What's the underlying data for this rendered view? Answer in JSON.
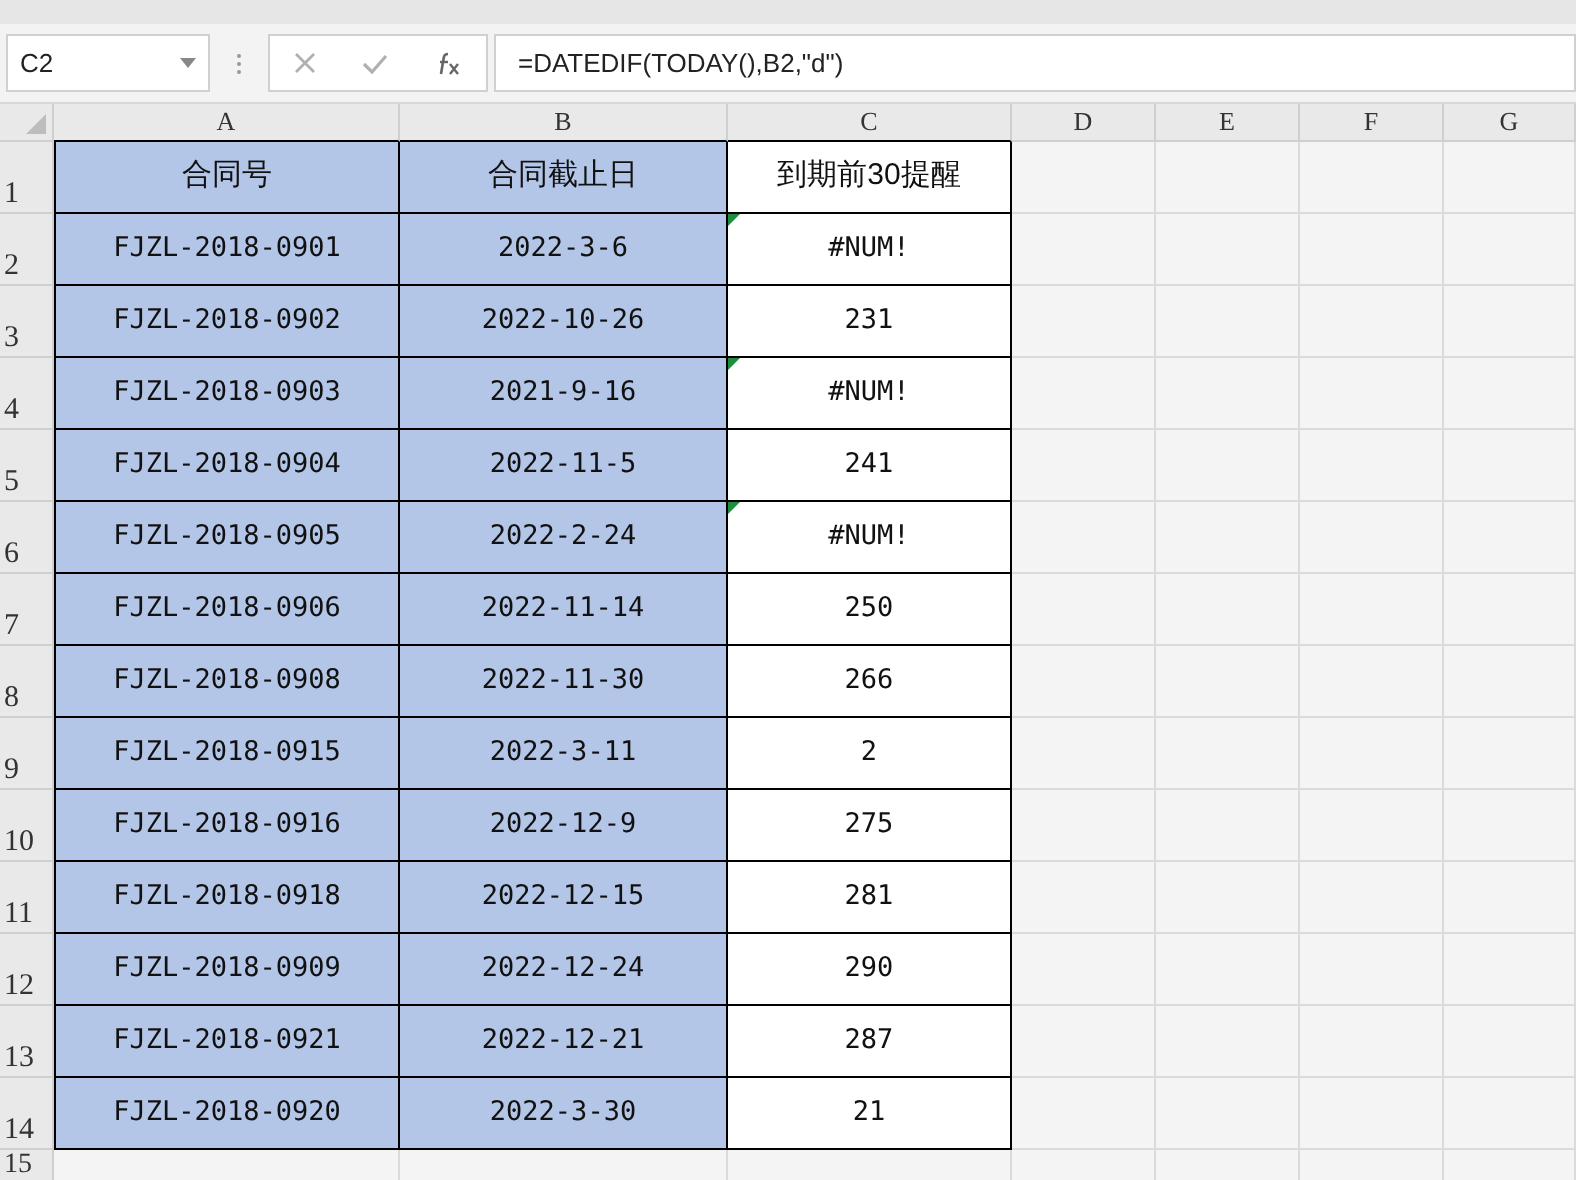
{
  "name_box": "C2",
  "formula": "=DATEDIF(TODAY(),B2,\"d\")",
  "columns": [
    "A",
    "B",
    "C",
    "D",
    "E",
    "F",
    "G"
  ],
  "rows": [
    {
      "number": "1",
      "cells": [
        "合同号",
        "合同截止日",
        "到期前30提醒"
      ],
      "flagged": false
    },
    {
      "number": "2",
      "cells": [
        "FJZL-2018-0901",
        "2022-3-6",
        "#NUM!"
      ],
      "flagged": true
    },
    {
      "number": "3",
      "cells": [
        "FJZL-2018-0902",
        "2022-10-26",
        "231"
      ],
      "flagged": false
    },
    {
      "number": "4",
      "cells": [
        "FJZL-2018-0903",
        "2021-9-16",
        "#NUM!"
      ],
      "flagged": true
    },
    {
      "number": "5",
      "cells": [
        "FJZL-2018-0904",
        "2022-11-5",
        "241"
      ],
      "flagged": false
    },
    {
      "number": "6",
      "cells": [
        "FJZL-2018-0905",
        "2022-2-24",
        "#NUM!"
      ],
      "flagged": true
    },
    {
      "number": "7",
      "cells": [
        "FJZL-2018-0906",
        "2022-11-14",
        "250"
      ],
      "flagged": false
    },
    {
      "number": "8",
      "cells": [
        "FJZL-2018-0908",
        "2022-11-30",
        "266"
      ],
      "flagged": false
    },
    {
      "number": "9",
      "cells": [
        "FJZL-2018-0915",
        "2022-3-11",
        "2"
      ],
      "flagged": false
    },
    {
      "number": "10",
      "cells": [
        "FJZL-2018-0916",
        "2022-12-9",
        "275"
      ],
      "flagged": false
    },
    {
      "number": "11",
      "cells": [
        "FJZL-2018-0918",
        "2022-12-15",
        "281"
      ],
      "flagged": false
    },
    {
      "number": "12",
      "cells": [
        "FJZL-2018-0909",
        "2022-12-24",
        "290"
      ],
      "flagged": false
    },
    {
      "number": "13",
      "cells": [
        "FJZL-2018-0921",
        "2022-12-21",
        "287"
      ],
      "flagged": false
    },
    {
      "number": "14",
      "cells": [
        "FJZL-2018-0920",
        "2022-3-30",
        "21"
      ],
      "flagged": false
    }
  ],
  "extra_rows": [
    "15"
  ]
}
